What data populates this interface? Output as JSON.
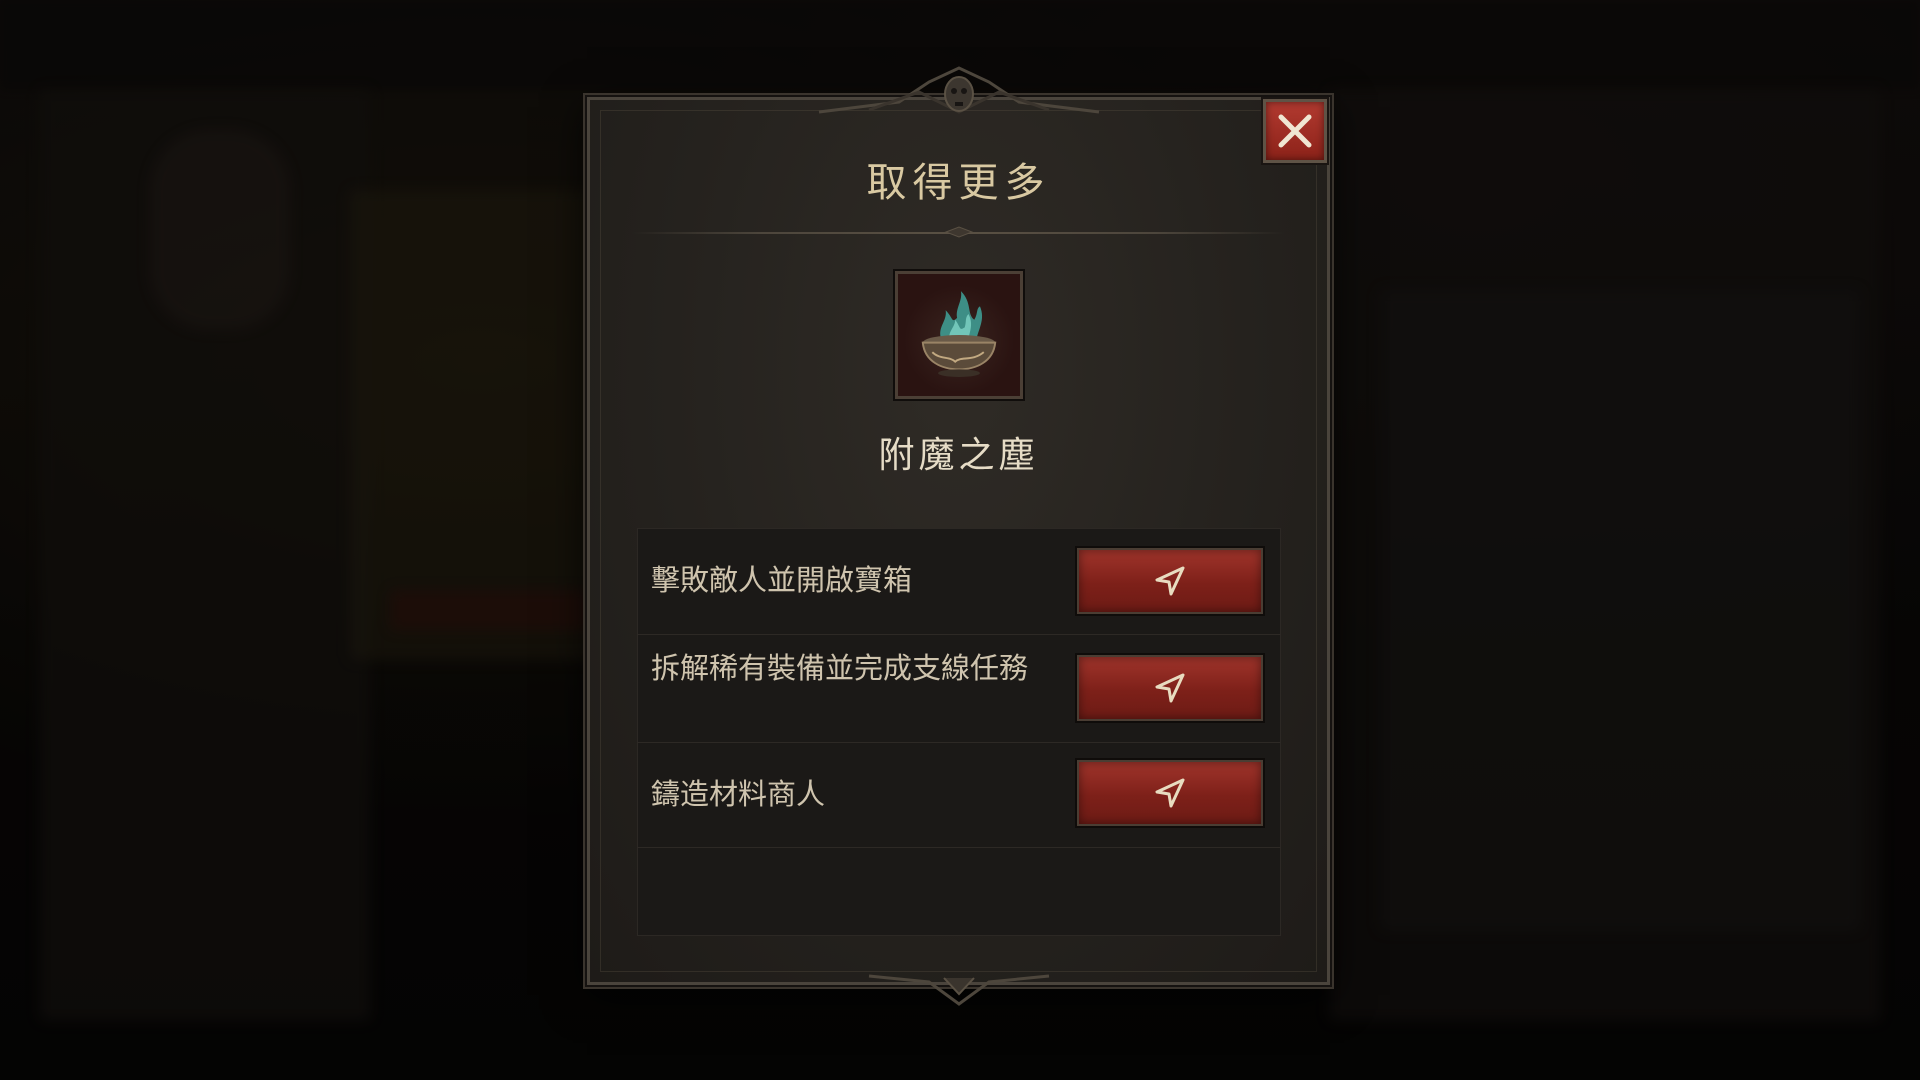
{
  "dialog": {
    "title": "取得更多",
    "close_icon": "close-x-icon",
    "item": {
      "name": "附魔之塵",
      "icon": "enchanting-dust-bowl-icon"
    },
    "sources": [
      {
        "label": "擊敗敵人並開啟寶箱",
        "button_icon": "navigate-arrow-icon"
      },
      {
        "label": "拆解稀有裝備並完成支線任務",
        "button_icon": "navigate-arrow-icon"
      },
      {
        "label": "鑄造材料商人",
        "button_icon": "navigate-arrow-icon"
      }
    ]
  },
  "colors": {
    "accent_red": "#8c2219",
    "title_gold": "#d9c9a2",
    "panel_dark": "#1b1917"
  }
}
